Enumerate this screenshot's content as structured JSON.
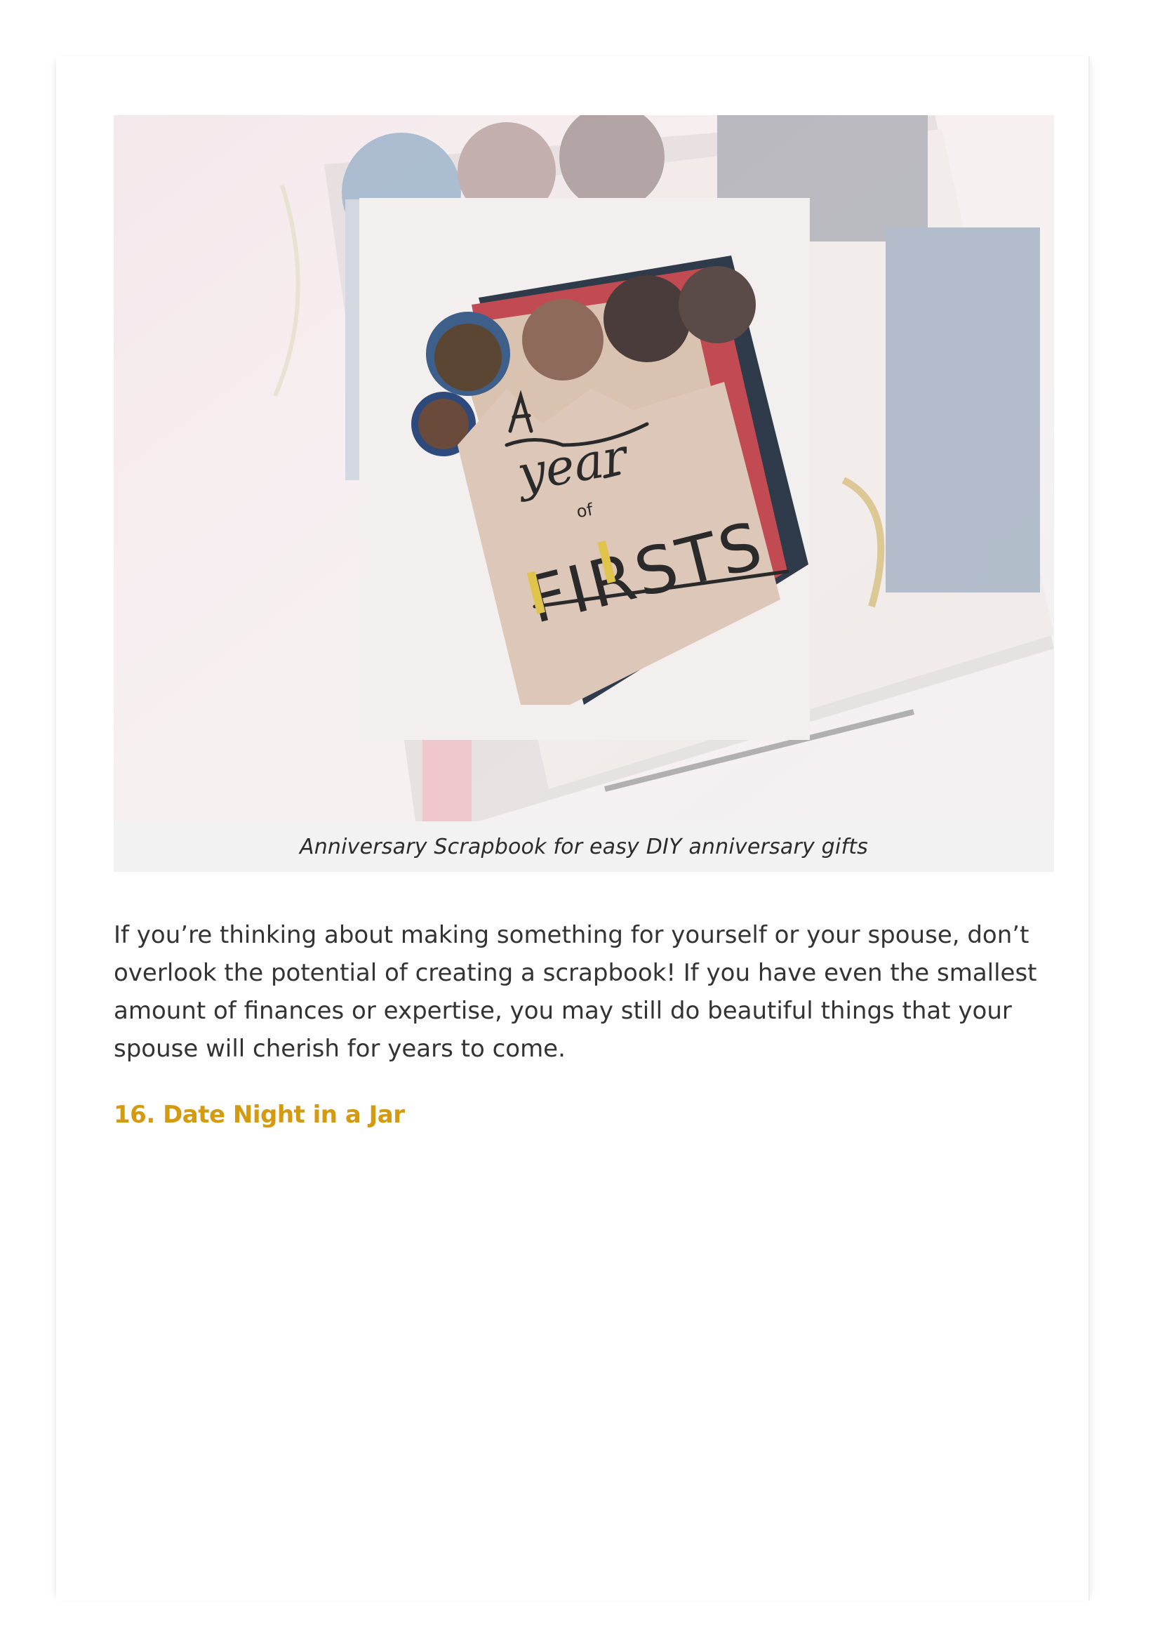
{
  "figure": {
    "image_alt": "Anniversary Scrapbook",
    "image_text": [
      "A",
      "year",
      "of",
      "FIRSTS"
    ],
    "caption": "Anniversary Scrapbook for easy DIY anniversary gifts"
  },
  "article": {
    "paragraph": "If you’re thinking about making something for yourself or your spouse, don’t overlook the potential of creating a scrapbook! If you have even the smallest amount of finances or expertise, you may still do beautiful things that your spouse will cherish for years to come.",
    "next_heading": "16. Date Night in a Jar"
  },
  "colors": {
    "heading_accent": "#d49a10",
    "body_text": "#333333",
    "caption_bg": "#f2f2f2"
  }
}
